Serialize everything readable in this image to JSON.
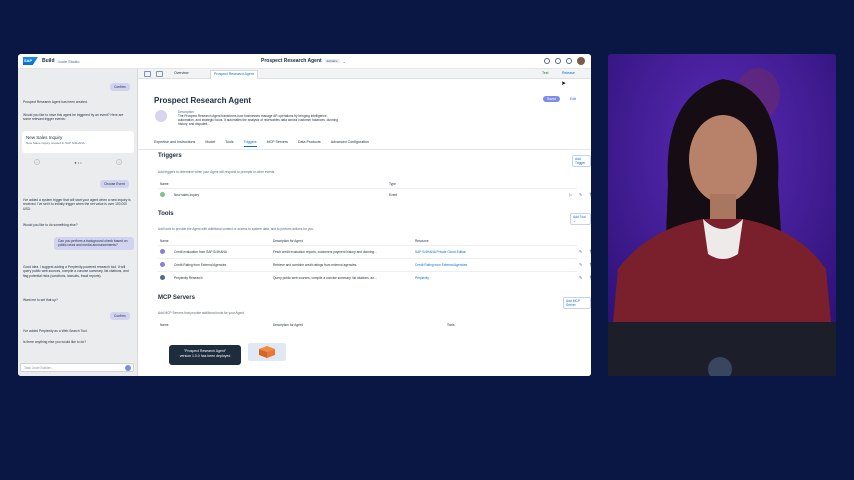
{
  "shell": {
    "brand": "Build",
    "product": "Joule Studio",
    "title": "Prospect Research Agent",
    "badge": "Editable"
  },
  "chat": {
    "confirm1": "Confirm",
    "msg1": "Prospect Research Agent has been created.",
    "msg2": "Would you like to have this agent be triggered by an event? Here are some relevant trigger events:",
    "card_title": "New Sales Inquiry",
    "card_sub": "New Sales Inquiry created in SAP S/4HANA",
    "choose_event": "Choose Event",
    "msg3": "I've added a system trigger that will start your agent when a new inquiry is received. I've set it to initially trigger when the net value is over 100.000 USD.",
    "msg4": "Would you like to do something else?",
    "user_msg": "Can you perform a background check based on public news and media announcements?",
    "msg5": "Good idea. I suggest adding a Perplexity-powered research tool. It will query public web sources, compile a concise summary, list citations, and flag potential risks (sanctions, lawsuits, fraud reports).",
    "msg6": "Want me to set that up?",
    "confirm2": "Confirm",
    "msg7": "I've added Perplexity as a Web Search Tool.",
    "msg8": "Is there anything else you would like to do?",
    "input_placeholder": "Task Joule Builder..."
  },
  "tabs": {
    "overview": "Overview",
    "agent": "Prospect Research Agent",
    "test": "Test",
    "release": "Release"
  },
  "agent": {
    "title": "Prospect Research Agent",
    "desc_label": "Description",
    "description": "The Prospect Research Agent transforms how businesses manage AR operations by bringing intelligence, automation, and strategic focus. It automates the analysis of receivables data across customer balances, dunning history, and disputed...",
    "status": "Saved",
    "edit": "Edit"
  },
  "subtabs": [
    "Expertise and Instructions",
    "Model",
    "Tools",
    "Triggers",
    "MCP Servers",
    "Data Products",
    "Advanced Configuration"
  ],
  "triggers": {
    "heading": "Triggers",
    "desc": "Add triggers to determine when your Agent will respond to prompts or other events.",
    "button": "Add Trigger",
    "col_name": "Name",
    "col_type": "Type",
    "rows": [
      {
        "name": "New sales inquiry",
        "type": "Event"
      }
    ]
  },
  "tools": {
    "heading": "Tools",
    "desc": "Add tools to provide the Agent with additional context or access to system data, and to perform actions for you.",
    "button": "Add Tool ⌄",
    "col_name": "Name",
    "col_desc": "Description for Agent",
    "col_resource": "Resource",
    "rows": [
      {
        "name": "Credit evaluation from SAP S/4HANA",
        "desc": "Fetch credit evaluation reports, customers payment history and dunning...",
        "resource": "SAP S/4HANA Private Cloud Edition"
      },
      {
        "name": "Credit Rating from External Agencies",
        "desc": "Retrieve and combine credit ratings from external agencies.",
        "resource": "Credit Rating from External Agencies"
      },
      {
        "name": "Perplexity Research",
        "desc": "Query public web sources, compile a concise summary, list citations, an...",
        "resource": "Perplexity"
      }
    ]
  },
  "mcp": {
    "heading": "MCP Servers",
    "desc": "Add MCP Servers that provide additional tools for your Agent.",
    "button": "Add MCP Server",
    "col_name": "Name",
    "col_desc": "Description for Agent",
    "col_tools": "Tools"
  },
  "toast": {
    "line1": "\"Prospect Research Agent\"",
    "line2": "version 1.0.0 has been deployed"
  },
  "colors": {
    "background": "#0a1744",
    "accent": "#7c8de8",
    "link": "#0a6ed1",
    "video_bg": "#3a1690"
  }
}
